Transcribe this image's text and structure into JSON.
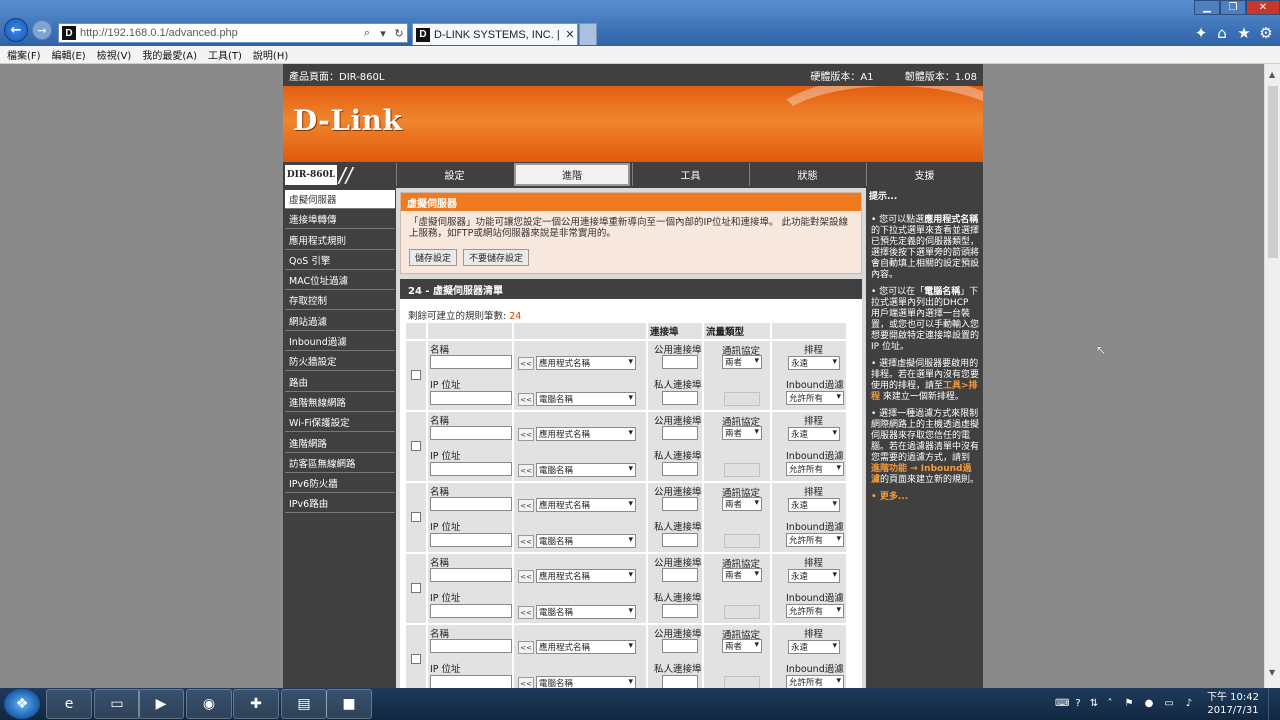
{
  "browser": {
    "address": "http://192.168.0.1/advanced.php",
    "tab_title": "D-LINK SYSTEMS, INC. | W...",
    "favicon": "D",
    "menu": [
      "檔案(F)",
      "編輯(E)",
      "檢視(V)",
      "我的最愛(A)",
      "工具(T)",
      "說明(H)"
    ],
    "icons": [
      "back-arrow-icon",
      "forward-arrow-icon",
      "search-icon",
      "refresh-icon",
      "home-icon",
      "star-icon",
      "gear-icon"
    ]
  },
  "router": {
    "product_label": "產品頁面：DIR-860L",
    "hardware_version": "硬體版本：A1",
    "firmware_version": "韌體版本：1.08",
    "logo": "D-Link",
    "model": "DIR-860L",
    "tabs": [
      "設定",
      "進階",
      "工具",
      "狀態",
      "支援"
    ],
    "active_tab": 1,
    "sidebar": [
      "虛擬伺服器",
      "連接埠轉傳",
      "應用程式規則",
      "QoS 引擎",
      "MAC位址過濾",
      "存取控制",
      "網站過濾",
      "Inbound過濾",
      "防火牆設定",
      "路由",
      "進階無線網路",
      "Wi-Fi保護設定",
      "進階網路",
      "訪客區無線網路",
      "IPv6防火牆",
      "IPv6路由"
    ],
    "active_sidebar": 0,
    "virtual_server": {
      "title": "虛擬伺服器",
      "description": "「虛擬伺服器」功能可讓您設定一個公用連接埠重新導向至一個內部的IP位址和連接埠。 此功能對架設線上服務，如FTP或網站伺服器來說是非常實用的。",
      "save_button": "儲存設定",
      "nosave_button": "不要儲存設定"
    },
    "list": {
      "title": "24 - 虛擬伺服器清單",
      "remaining_label": "剩餘可建立的規則筆數:",
      "remaining_count": "24",
      "header_port": "連接埠",
      "header_traffic": "流量類型",
      "label_name": "名稱",
      "label_ip": "IP 位址",
      "label_public_port": "公用連接埠",
      "label_private_port": "私人連接埠",
      "label_protocol": "通訊協定",
      "label_schedule": "排程",
      "label_inbound": "Inbound過濾",
      "arrow_button": "<<",
      "app_select": "應用程式名稱",
      "pc_select": "電腦名稱",
      "protocol_value": "兩者",
      "schedule_value": "永遠",
      "inbound_value": "允許所有",
      "rule_count": 5
    },
    "hints": {
      "title": "提示...",
      "items": [
        {
          "prefix": "您可以點選",
          "bold": "應用程式名稱",
          "suffix": "的下拉式選單來查看並選擇已預先定義的伺服器類型，選擇後按下選單旁的箭頭將會自動填上相關的設定預設內容。"
        },
        {
          "prefix": "您可以在「",
          "bold": "電腦名稱",
          "suffix": "」下拉式選單內列出的DHCP 用戶端選單內選擇一台裝置，或您也可以手動輸入您想要開啟特定連接埠設置的 IP 位址。"
        },
        {
          "prefix": "選擇虛擬伺服器要啟用的排程。若在選單內沒有您要使用的排程，請至",
          "orange": "工具>排程",
          "suffix": " 來建立一個新排程。"
        },
        {
          "prefix": "選擇一種過濾方式來限制網際網路上的主機透過虛擬伺服器來存取您信任的電腦。若在過濾器清單中沒有您需要的過濾方式，請到 ",
          "orange": "進階功能 → Inbound過濾",
          "suffix": "的頁面來建立新的規則。"
        }
      ],
      "more": "更多..."
    }
  },
  "taskbar": {
    "apps": [
      "ie-icon",
      "folder-icon",
      "media-player-icon",
      "chrome-icon",
      "network-icon",
      "sticky-notes-icon",
      "app-icon"
    ],
    "time": "下午 10:42",
    "date": "2017/7/31"
  }
}
